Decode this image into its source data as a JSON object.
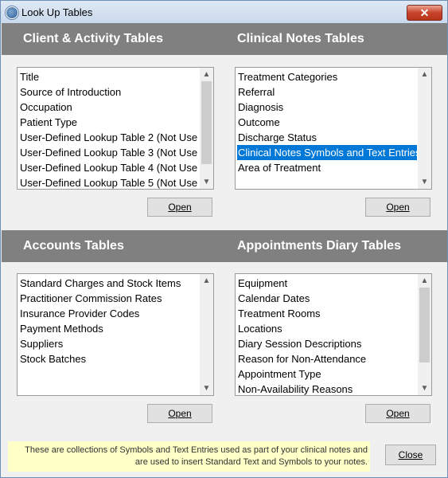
{
  "window": {
    "title": "Look Up Tables",
    "close_glyph": "✕"
  },
  "panels": {
    "client": {
      "header": "Client & Activity Tables",
      "items": [
        "Title",
        "Source of Introduction",
        "Occupation",
        "Patient Type",
        "User-Defined Lookup Table 2 (Not Use",
        "User-Defined Lookup Table 3 (Not Use",
        "User-Defined Lookup Table 4 (Not Use",
        "User-Defined Lookup Table 5 (Not Use"
      ],
      "open_label": "Open"
    },
    "clinical": {
      "header": "Clinical Notes Tables",
      "items": [
        "Treatment Categories",
        "Referral",
        "Diagnosis",
        "Outcome",
        "Discharge Status",
        "Clinical Notes Symbols and Text Entries",
        "Area of Treatment"
      ],
      "selected_index": 5,
      "open_label": "Open"
    },
    "accounts": {
      "header": "Accounts Tables",
      "items": [
        "Standard Charges and Stock Items",
        "Practitioner Commission Rates",
        "Insurance Provider Codes",
        "Payment Methods",
        "Suppliers",
        "Stock Batches"
      ],
      "open_label": "Open"
    },
    "appointments": {
      "header": "Appointments Diary Tables",
      "items": [
        "Equipment",
        "Calendar Dates",
        "Treatment Rooms",
        "Locations",
        "Diary Session Descriptions",
        "Reason for Non-Attendance",
        "Appointment Type",
        "Non-Availability Reasons"
      ],
      "open_label": "Open"
    }
  },
  "footer": {
    "info_line1": "These are collections of Symbols and Text Entries used as part of your clinical notes and",
    "info_line2": "are used to insert Standard Text and Symbols to your notes.",
    "close_label": "Close"
  },
  "scroll_glyphs": {
    "up": "▲",
    "down": "▼"
  }
}
